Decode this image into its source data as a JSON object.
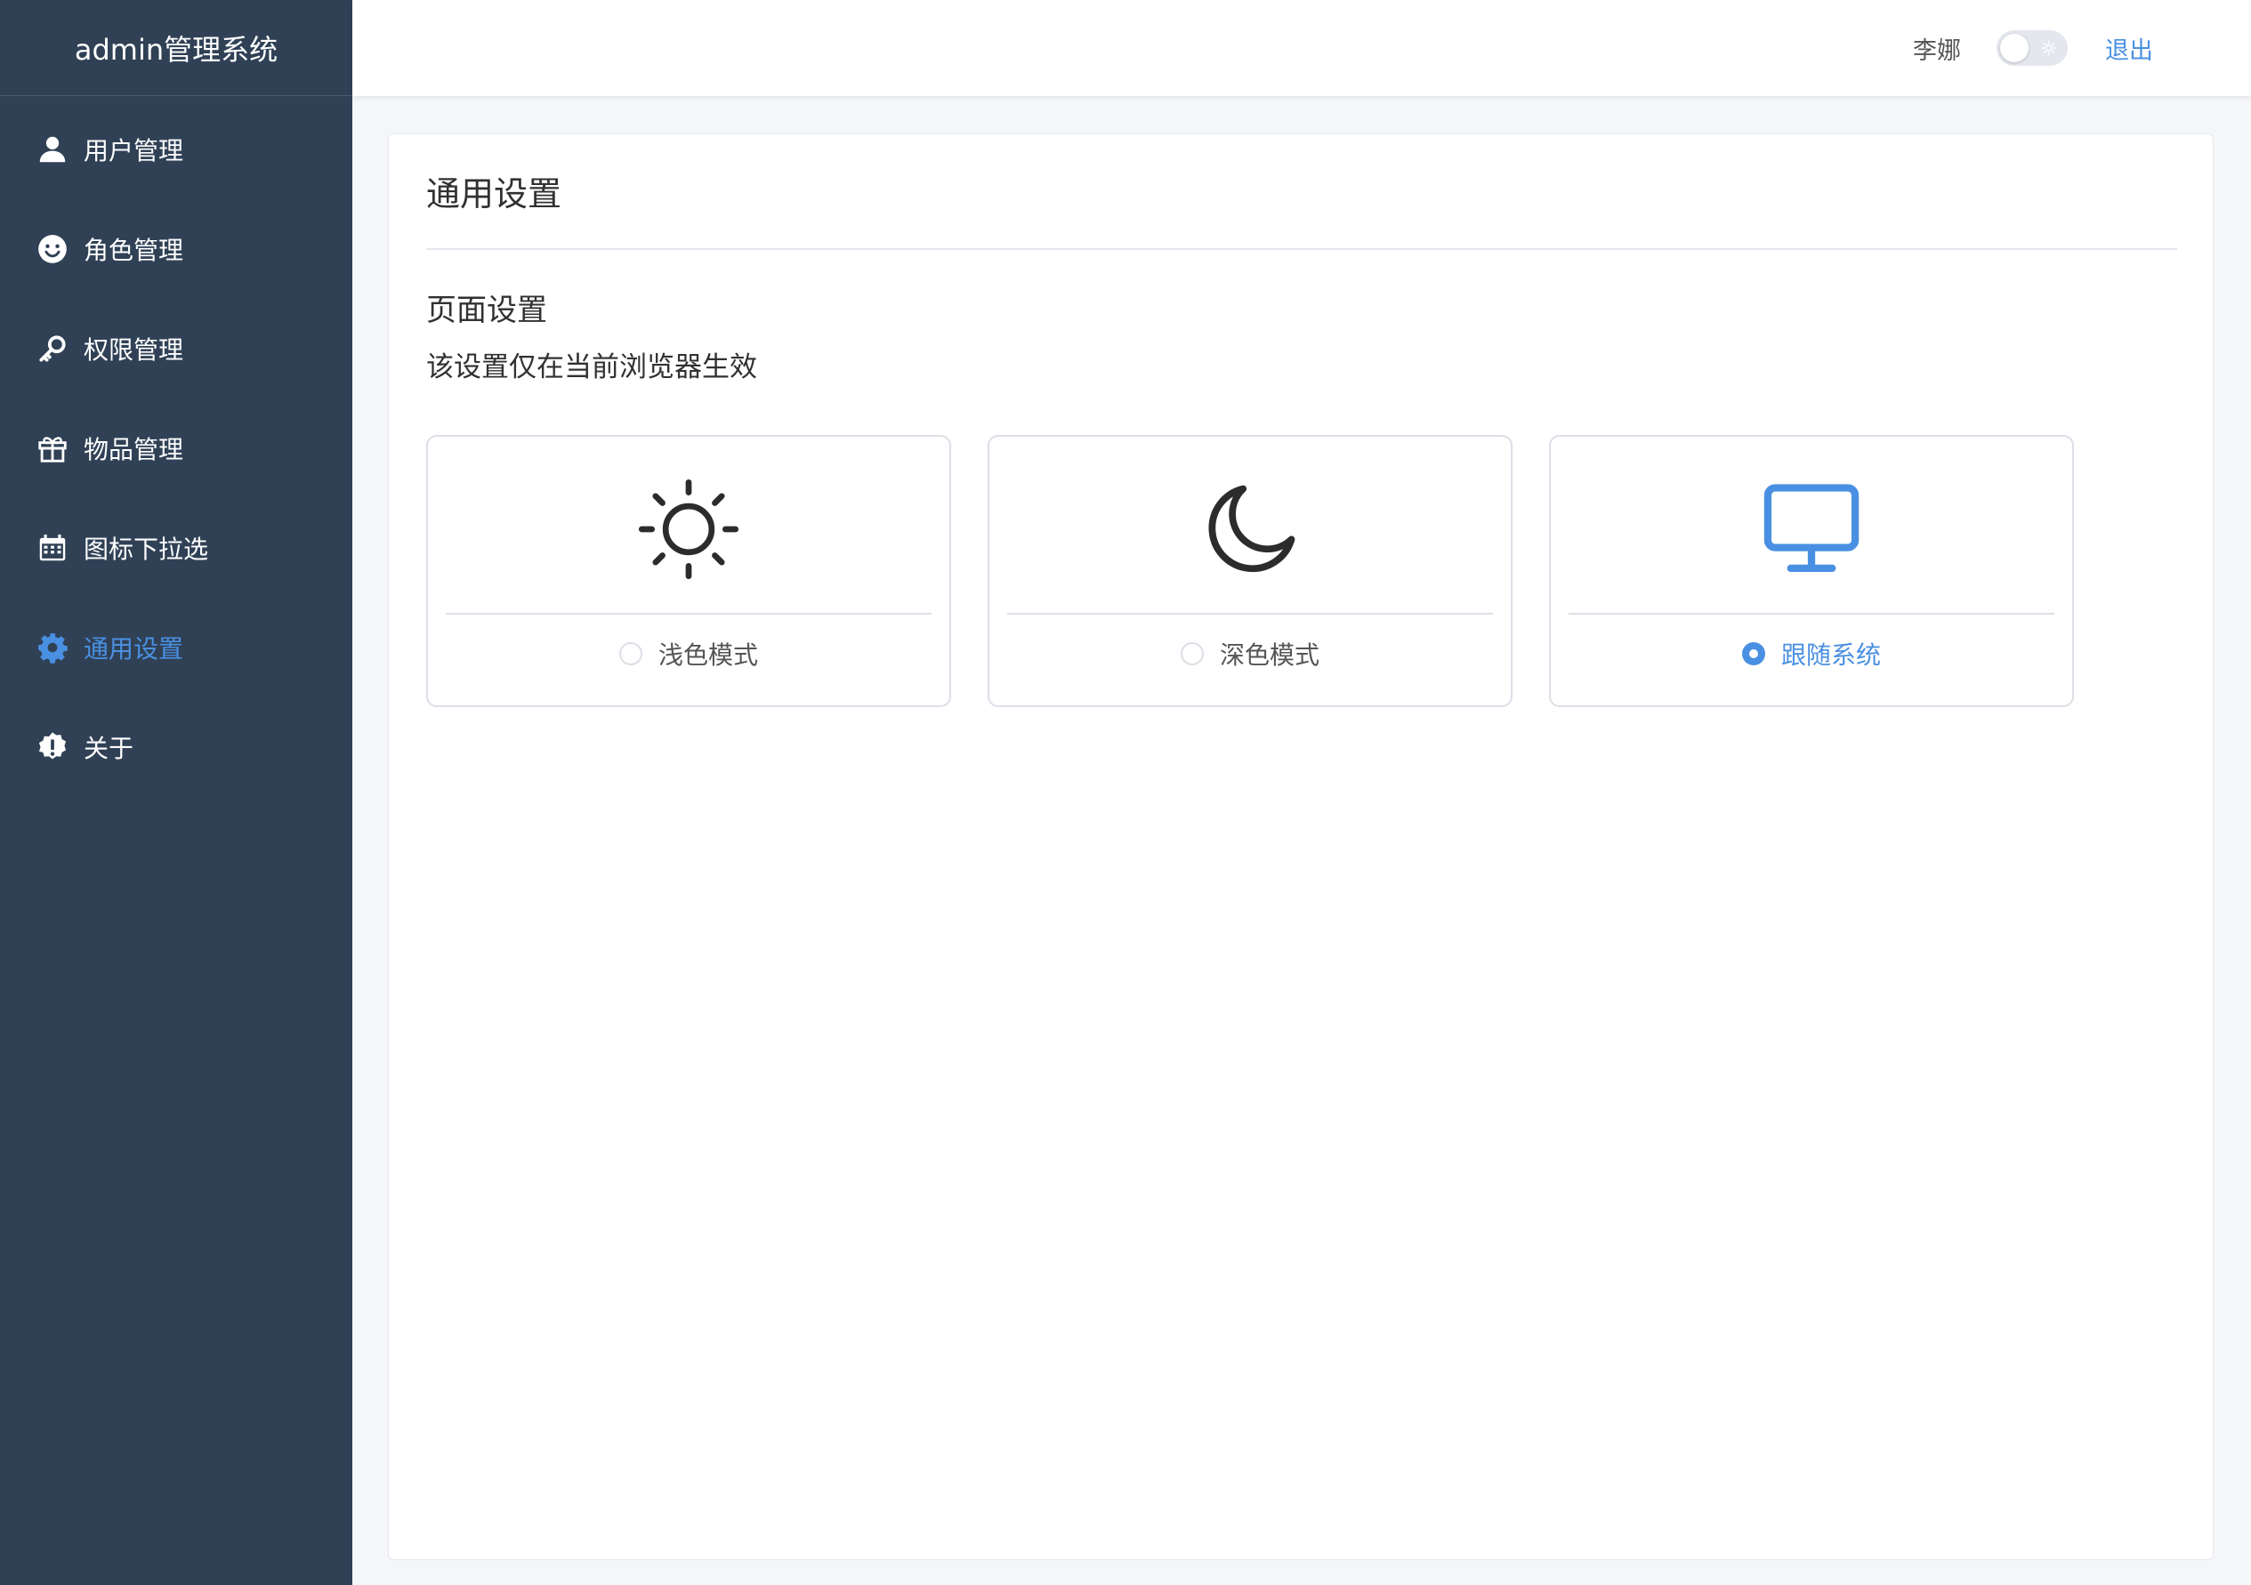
{
  "app": {
    "title": "admin管理系统"
  },
  "sidebar": {
    "items": [
      {
        "label": "用户管理",
        "icon": "user-icon",
        "active": false
      },
      {
        "label": "角色管理",
        "icon": "smile-icon",
        "active": false
      },
      {
        "label": "权限管理",
        "icon": "key-icon",
        "active": false
      },
      {
        "label": "物品管理",
        "icon": "gift-icon",
        "active": false
      },
      {
        "label": "图标下拉选",
        "icon": "calendar-icon",
        "active": false
      },
      {
        "label": "通用设置",
        "icon": "gear-icon",
        "active": true
      },
      {
        "label": "关于",
        "icon": "info-badge-icon",
        "active": false
      }
    ]
  },
  "header": {
    "username": "李娜",
    "theme_switch_icon": "sun-icon",
    "logout_label": "退出"
  },
  "settings": {
    "title": "通用设置",
    "section_title": "页面设置",
    "section_desc": "该设置仅在当前浏览器生效",
    "options": [
      {
        "label": "浅色模式",
        "icon": "sun-icon",
        "selected": false
      },
      {
        "label": "深色模式",
        "icon": "moon-icon",
        "selected": false
      },
      {
        "label": "跟随系统",
        "icon": "monitor-icon",
        "selected": true
      }
    ]
  },
  "colors": {
    "sidebar_bg": "#304156",
    "accent": "#4a90e2",
    "text": "#303133",
    "border": "#dcdfe6"
  }
}
